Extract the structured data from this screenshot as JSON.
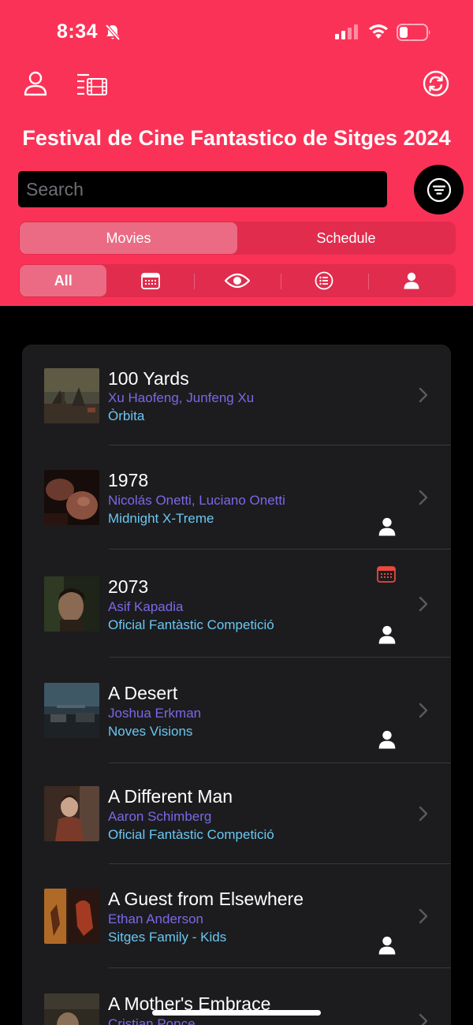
{
  "status_bar": {
    "time": "8:34"
  },
  "header": {
    "title": "Festival de Cine Fantastico de Sitges 2024"
  },
  "search": {
    "placeholder": "Search"
  },
  "tabs": [
    {
      "label": "Movies",
      "active": true
    },
    {
      "label": "Schedule",
      "active": false
    }
  ],
  "filters": [
    {
      "label": "All",
      "icon": "text",
      "active": true
    },
    {
      "label": "",
      "icon": "calendar-icon",
      "active": false
    },
    {
      "label": "",
      "icon": "eye-icon",
      "active": false
    },
    {
      "label": "",
      "icon": "list-icon",
      "active": false
    },
    {
      "label": "",
      "icon": "person-icon",
      "active": false
    }
  ],
  "colors": {
    "accent": "#fb3257",
    "director": "#7a68e8",
    "section": "#6ac7f2",
    "calendar_badge": "#e8483f"
  },
  "movies": [
    {
      "title": "100 Yards",
      "director": "Xu Haofeng, Junfeng Xu",
      "section": "Òrbita",
      "has_calendar": false,
      "has_person": false
    },
    {
      "title": "1978",
      "director": "Nicolás Onetti, Luciano Onetti",
      "section": "Midnight X-Treme",
      "has_calendar": false,
      "has_person": true
    },
    {
      "title": "2073",
      "director": "Asif Kapadia",
      "section": "Oficial Fantàstic Competició",
      "has_calendar": true,
      "has_person": true
    },
    {
      "title": "A Desert",
      "director": "Joshua Erkman",
      "section": "Noves Visions",
      "has_calendar": false,
      "has_person": true
    },
    {
      "title": "A Different Man",
      "director": "Aaron Schimberg",
      "section": "Oficial Fantàstic Competició",
      "has_calendar": false,
      "has_person": false
    },
    {
      "title": "A Guest from Elsewhere",
      "director": "Ethan Anderson",
      "section": "Sitges Family - Kids",
      "has_calendar": false,
      "has_person": true
    },
    {
      "title": "A Mother's Embrace",
      "director": "Cristian Ponce",
      "section": "",
      "has_calendar": false,
      "has_person": false
    }
  ]
}
